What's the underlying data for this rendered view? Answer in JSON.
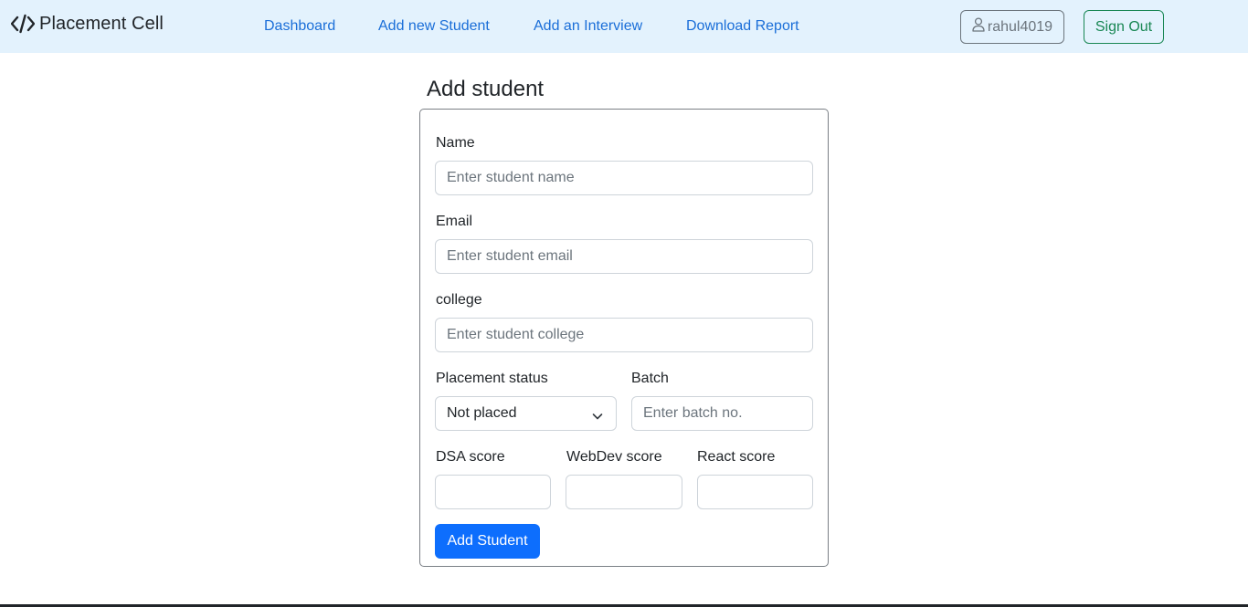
{
  "navbar": {
    "brand": "Placement Cell",
    "links": [
      "Dashboard",
      "Add new Student",
      "Add an Interview",
      "Download Report"
    ],
    "username": "rahul4019",
    "signout_label": "Sign Out"
  },
  "page": {
    "title": "Add student"
  },
  "form": {
    "name": {
      "label": "Name",
      "placeholder": "Enter student name"
    },
    "email": {
      "label": "Email",
      "placeholder": "Enter student email"
    },
    "college": {
      "label": "college",
      "placeholder": "Enter student college"
    },
    "placement_status": {
      "label": "Placement status",
      "selected": "Not placed"
    },
    "batch": {
      "label": "Batch",
      "placeholder": "Enter batch no."
    },
    "dsa_score": {
      "label": "DSA score",
      "placeholder": ""
    },
    "webdev_score": {
      "label": "WebDev score",
      "placeholder": ""
    },
    "react_score": {
      "label": "React score",
      "placeholder": ""
    },
    "submit_label": "Add Student"
  },
  "icons": {
    "brand": "code-slash-icon",
    "user": "person-icon",
    "select": "chevron-down-icon"
  },
  "colors": {
    "navbar_bg": "#e3f2fd",
    "link": "#1a6ed8",
    "primary": "#0d6efd",
    "success": "#198754",
    "secondary": "#6c757d"
  }
}
